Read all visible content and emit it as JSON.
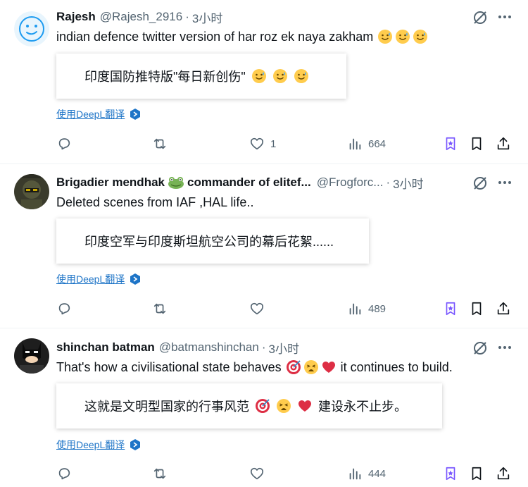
{
  "colors": {
    "text": "#0f1419",
    "muted": "#536471",
    "link": "#1d74c7",
    "divider": "#eff3f4",
    "accent": "#1d9bf0",
    "purple": "#7856ff"
  },
  "tweets": [
    {
      "name": "Rajesh",
      "handle": "@Rajesh_2916",
      "dot": "·",
      "time": "3小时",
      "text": "indian defence twitter version of har roz ek naya zakham",
      "emojis": [
        "sweat-smile-face",
        "sweat-smile-face",
        "sweat-smile-face"
      ],
      "translation": "印度国防推特版\"每日新创伤\"",
      "translation_emojis": [
        "sweat-smile-face",
        "sweat-smile-face",
        "sweat-smile-face"
      ],
      "deepl_label": "使用DeepL翻译",
      "replies": "",
      "retweets": "",
      "likes": "1",
      "views": "664"
    },
    {
      "name": "Brigadier mendhak",
      "name_suffix": "commander of elitef...",
      "handle": "@Frogforc...",
      "dot": "·",
      "time": "3小时",
      "text": "Deleted scenes from IAF ,HAL life..",
      "translation": "印度空军与印度斯坦航空公司的幕后花絮......",
      "deepl_label": "使用DeepL翻译",
      "replies": "",
      "retweets": "",
      "likes": "",
      "views": "489"
    },
    {
      "name": "shinchan batman",
      "handle": "@batmanshinchan",
      "dot": "·",
      "time": "3小时",
      "text_before": "That's how a civilisational state behaves",
      "text_after": "it continues to build.",
      "emojis": [
        "dart-target",
        "weary-face",
        "red-heart"
      ],
      "translation_before": "这就是文明型国家的行事风范",
      "translation_after": "建设永不止步。",
      "deepl_label": "使用DeepL翻译",
      "replies": "",
      "retweets": "",
      "likes": "",
      "views": "444"
    }
  ]
}
